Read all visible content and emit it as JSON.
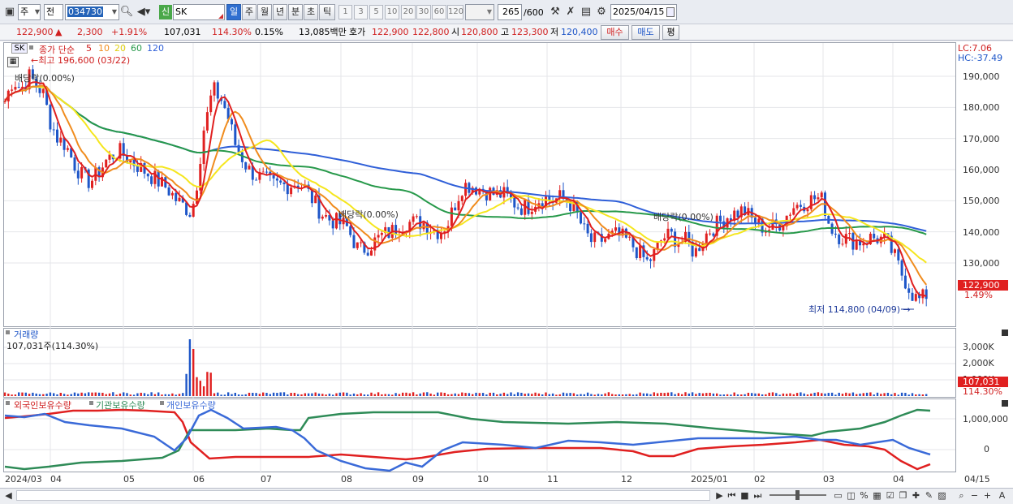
{
  "toolbar": {
    "period_select": "주",
    "prev_label": "전",
    "code_value": "034730",
    "badge_new": "신",
    "stock_name": "SK",
    "periods": [
      "일",
      "주",
      "월",
      "년",
      "분",
      "초",
      "틱"
    ],
    "active_period": "일",
    "intervals": [
      "1",
      "3",
      "5",
      "10",
      "20",
      "30",
      "60",
      "120"
    ],
    "count_value": "265",
    "count_total": "/600",
    "date_value": "2025/04/15"
  },
  "quote": {
    "price": "122,900",
    "change_arrow": "▲",
    "change": "2,300",
    "change_pct": "+1.91%",
    "volume": "107,031",
    "volume_ratio": "114.30%",
    "turnover": "0.15%",
    "amount": "13,085백만",
    "ask_label": "호가",
    "ask": "122,900",
    "bid": "122,800",
    "open_label": "시",
    "open": "120,800",
    "high_label": "고",
    "high": "123,300",
    "low_label": "저",
    "low": "120,400",
    "buy_label": "매수",
    "sell_label": "매도",
    "avg_label": "평"
  },
  "price_panel": {
    "code_tag": "SK",
    "legend_prefix": "종가 단순",
    "ma_periods": [
      "5",
      "10",
      "20",
      "60",
      "120"
    ],
    "high_note": "최고 196,600 (03/22)",
    "low_note": "최저 114,800 (04/09)",
    "dividend_notes": [
      "배당락(0.00%)",
      "배당락(0.00%)",
      "배당락(0.00%)"
    ],
    "lc": "LC:7.06",
    "hc": "HC:-37.49",
    "last_price_tag": "122,900",
    "last_pct": "1.49%",
    "y_ticks": [
      "190,000",
      "180,000",
      "170,000",
      "160,000",
      "150,000",
      "140,000",
      "130,000"
    ]
  },
  "volume_panel": {
    "title": "거래량",
    "value_note": "107,031주(114.30%)",
    "y_ticks": [
      "3,000K",
      "2,000K",
      "1,000K"
    ],
    "last_tag": "107,031",
    "last_pct": "114.30%"
  },
  "holdings_panel": {
    "legend": [
      "외국인보유수량",
      "기관보유수량",
      "개인보유수량"
    ],
    "y_ticks": [
      "1,000,000",
      "0"
    ]
  },
  "x_axis": [
    "2024/03",
    "04",
    "05",
    "06",
    "07",
    "08",
    "09",
    "10",
    "11",
    "12",
    "2025/01",
    "02",
    "03",
    "04",
    "04/15"
  ],
  "colors": {
    "up": "#e02020",
    "down": "#1e56c8",
    "ma5": "#e02020",
    "ma10": "#f08c1e",
    "ma20": "#f5e61e",
    "ma60": "#27994a",
    "ma120": "#2f5fd8",
    "foreign": "#e02020",
    "inst": "#2e8b57",
    "retail": "#3a6ad8"
  },
  "chart_data": {
    "type": "candlestick",
    "series": [
      {
        "name": "종가 단순 5",
        "values": []
      },
      {
        "name": "10",
        "values": []
      },
      {
        "name": "20",
        "values": []
      },
      {
        "name": "60",
        "values": []
      },
      {
        "name": "120",
        "values": []
      }
    ],
    "ylim": [
      110000,
      200000
    ],
    "x_start": "2024/03",
    "x_end": "2025/04/15",
    "close_path": [
      [
        0,
        182000
      ],
      [
        10,
        189000
      ],
      [
        20,
        186000
      ],
      [
        30,
        190000
      ],
      [
        40,
        187000
      ],
      [
        48,
        184000
      ],
      [
        55,
        176000
      ],
      [
        65,
        170000
      ],
      [
        75,
        168000
      ],
      [
        85,
        162000
      ],
      [
        95,
        158000
      ],
      [
        105,
        156000
      ],
      [
        115,
        159000
      ],
      [
        125,
        163000
      ],
      [
        140,
        166000
      ],
      [
        155,
        163000
      ],
      [
        170,
        160000
      ],
      [
        185,
        157000
      ],
      [
        200,
        154000
      ],
      [
        212,
        150000
      ],
      [
        222,
        148000
      ],
      [
        230,
        146000
      ],
      [
        238,
        158000
      ],
      [
        244,
        172000
      ],
      [
        250,
        178000
      ],
      [
        256,
        186000
      ],
      [
        262,
        184000
      ],
      [
        268,
        182000
      ],
      [
        276,
        176000
      ],
      [
        284,
        168000
      ],
      [
        292,
        164000
      ],
      [
        300,
        160000
      ],
      [
        310,
        158000
      ],
      [
        320,
        157000
      ],
      [
        330,
        155000
      ],
      [
        340,
        155000
      ],
      [
        350,
        155000
      ],
      [
        360,
        156000
      ],
      [
        370,
        154000
      ],
      [
        380,
        150000
      ],
      [
        390,
        146000
      ],
      [
        400,
        144000
      ],
      [
        410,
        143000
      ],
      [
        420,
        142000
      ],
      [
        428,
        138000
      ],
      [
        436,
        134000
      ],
      [
        446,
        135000
      ],
      [
        456,
        137000
      ],
      [
        466,
        139000
      ],
      [
        476,
        140000
      ],
      [
        486,
        142000
      ],
      [
        496,
        143000
      ],
      [
        506,
        143000
      ],
      [
        516,
        143000
      ],
      [
        526,
        141000
      ],
      [
        536,
        140000
      ],
      [
        546,
        143000
      ],
      [
        556,
        150000
      ],
      [
        564,
        155000
      ],
      [
        574,
        155000
      ],
      [
        584,
        154000
      ],
      [
        594,
        153000
      ],
      [
        604,
        152000
      ],
      [
        614,
        152000
      ],
      [
        624,
        150000
      ],
      [
        634,
        148000
      ],
      [
        644,
        148000
      ],
      [
        654,
        150000
      ],
      [
        664,
        151000
      ],
      [
        674,
        150000
      ],
      [
        684,
        151000
      ],
      [
        694,
        150000
      ],
      [
        704,
        146000
      ],
      [
        714,
        140000
      ],
      [
        722,
        137000
      ],
      [
        732,
        137000
      ],
      [
        742,
        138000
      ],
      [
        752,
        139000
      ],
      [
        762,
        138000
      ],
      [
        772,
        136000
      ],
      [
        782,
        133000
      ],
      [
        792,
        130000
      ],
      [
        800,
        133000
      ],
      [
        810,
        138000
      ],
      [
        820,
        139000
      ],
      [
        830,
        137000
      ],
      [
        840,
        137000
      ],
      [
        850,
        133000
      ],
      [
        860,
        138000
      ],
      [
        870,
        141000
      ],
      [
        880,
        143000
      ],
      [
        890,
        145000
      ],
      [
        900,
        146000
      ],
      [
        910,
        147000
      ],
      [
        920,
        144000
      ],
      [
        930,
        142000
      ],
      [
        940,
        141000
      ],
      [
        950,
        142000
      ],
      [
        960,
        144000
      ],
      [
        970,
        148000
      ],
      [
        980,
        149000
      ],
      [
        990,
        150000
      ],
      [
        1000,
        151000
      ],
      [
        1008,
        150000
      ],
      [
        1016,
        142000
      ],
      [
        1026,
        139000
      ],
      [
        1036,
        138000
      ],
      [
        1046,
        137000
      ],
      [
        1056,
        137000
      ],
      [
        1066,
        138000
      ],
      [
        1076,
        138000
      ],
      [
        1086,
        137000
      ],
      [
        1096,
        132000
      ],
      [
        1104,
        127000
      ],
      [
        1112,
        123000
      ],
      [
        1120,
        119000
      ],
      [
        1128,
        118000
      ],
      [
        1136,
        120000
      ],
      [
        1142,
        122900
      ]
    ],
    "volume": [],
    "title": "SK"
  }
}
